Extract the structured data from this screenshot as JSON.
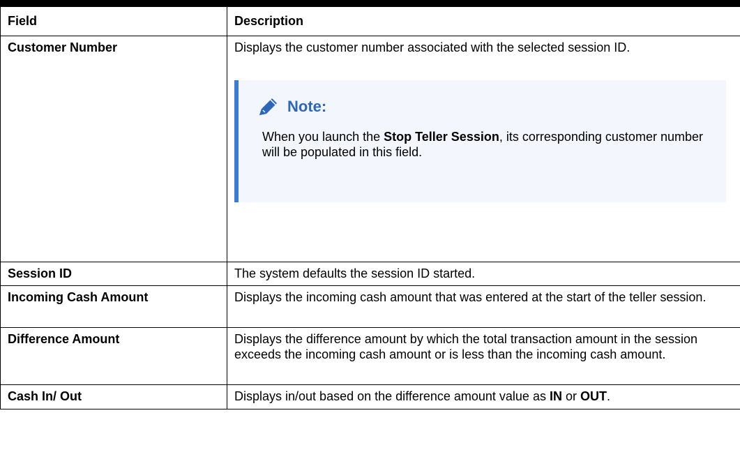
{
  "table": {
    "headers": {
      "field": "Field",
      "description": "Description"
    },
    "rows": [
      {
        "field": "Customer Number",
        "description": "Displays the customer number associated with the selected session ID.",
        "note": {
          "title": "Note:",
          "text_pre": "When you launch the ",
          "text_bold": "Stop Teller Session",
          "text_post": ", its corresponding customer number will be populated in this field."
        }
      },
      {
        "field": "Session ID",
        "description": "The system defaults the session ID started."
      },
      {
        "field": "Incoming Cash Amount",
        "description": "Displays the incoming cash amount that was entered at the start of the teller session."
      },
      {
        "field": "Difference Amount",
        "description": "Displays the difference amount by which the total transaction amount in the session exceeds the incoming cash amount or is less than the incoming cash amount."
      },
      {
        "field": "Cash In/ Out",
        "description_pre": "Displays in/out based on the difference amount value as ",
        "bold1": "IN",
        "mid": " or ",
        "bold2": "OUT",
        "end": "."
      }
    ]
  },
  "colors": {
    "note_accent": "#3a7bd5",
    "note_title": "#2c67b9",
    "note_bg": "#f3f6fc"
  },
  "icons": {
    "note_icon": "pencil-icon"
  }
}
